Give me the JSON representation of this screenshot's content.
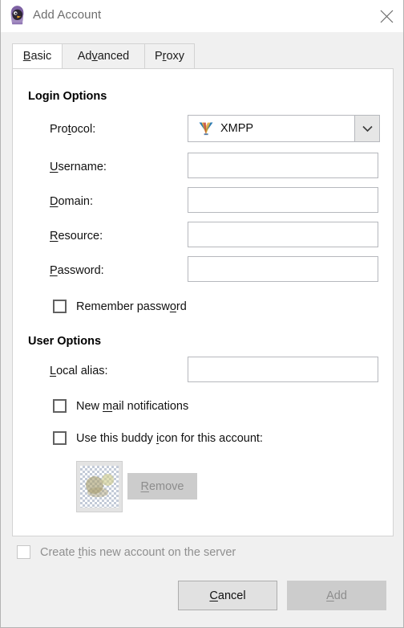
{
  "window": {
    "title": "Add Account",
    "icon": "pidgin-logo-icon",
    "close_icon": "close-icon"
  },
  "tabs": [
    {
      "id": "basic",
      "label_pre": "",
      "label_mnemonic": "B",
      "label_post": "asic",
      "active": true
    },
    {
      "id": "advanced",
      "label_pre": "Ad",
      "label_mnemonic": "v",
      "label_post": "anced",
      "active": false
    },
    {
      "id": "proxy",
      "label_pre": "P",
      "label_mnemonic": "r",
      "label_post": "oxy",
      "active": false
    }
  ],
  "login_options": {
    "title": "Login Options",
    "protocol": {
      "label_pre": "Pro",
      "label_mnemonic": "t",
      "label_post": "ocol:",
      "value": "XMPP",
      "icon": "xmpp-protocol-icon",
      "arrow_icon": "chevron-down-icon"
    },
    "username": {
      "label_pre": "",
      "label_mnemonic": "U",
      "label_post": "sername:",
      "value": "",
      "placeholder": ""
    },
    "domain": {
      "label_pre": "",
      "label_mnemonic": "D",
      "label_post": "omain:",
      "value": "",
      "placeholder": ""
    },
    "resource": {
      "label_pre": "",
      "label_mnemonic": "R",
      "label_post": "esource:",
      "value": "",
      "placeholder": ""
    },
    "password": {
      "label_pre": "",
      "label_mnemonic": "P",
      "label_post": "assword:",
      "value": "",
      "placeholder": ""
    },
    "remember_password": {
      "label_pre": "Remember passw",
      "label_mnemonic": "o",
      "label_post": "rd",
      "checked": false,
      "enabled": true
    }
  },
  "user_options": {
    "title": "User Options",
    "local_alias": {
      "label_pre": "",
      "label_mnemonic": "L",
      "label_post": "ocal alias:",
      "value": "",
      "placeholder": ""
    },
    "new_mail": {
      "label_pre": "New ",
      "label_mnemonic": "m",
      "label_post": "ail notifications",
      "checked": false,
      "enabled": true
    },
    "use_buddy_icon": {
      "label_pre": "Use this buddy ",
      "label_mnemonic": "i",
      "label_post": "con for this account:",
      "checked": false,
      "enabled": true
    },
    "buddy_icon": {
      "name": "buddy-icon-preview",
      "state": "empty"
    },
    "remove_button": {
      "label_pre": "",
      "label_mnemonic": "R",
      "label_post": "emove",
      "enabled": false
    }
  },
  "footer": {
    "create_account": {
      "label_pre": "Create ",
      "label_mnemonic": "t",
      "label_post": "his new account on the server",
      "checked": false,
      "enabled": false
    },
    "cancel_button": {
      "label_pre": "",
      "label_mnemonic": "C",
      "label_post": "ancel",
      "enabled": true
    },
    "add_button": {
      "label_pre": "",
      "label_mnemonic": "A",
      "label_post": "dd",
      "enabled": false
    }
  },
  "colors": {
    "window_bg": "#f0f0f0",
    "panel_bg": "#ffffff",
    "title_text": "#6e6e6e",
    "border": "#d3d3d3",
    "input_border": "#b6b8bd",
    "button_bg": "#e1e1e1",
    "button_disabled_bg": "#cccccc",
    "disabled_text": "#8f8f8f"
  }
}
